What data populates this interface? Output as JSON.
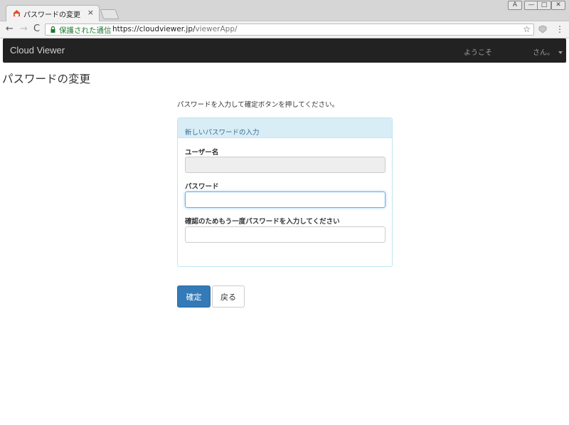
{
  "browser": {
    "tab_title": "パスワードの変更",
    "tab_close": "×",
    "secure_label": "保護された通信",
    "url_host": "https://cloudviewer.jp/",
    "url_path": "viewerApp/",
    "star": "☆",
    "back": "←",
    "forward": "→",
    "reload": "C",
    "menu": "⋮",
    "window_buttons": [
      "A",
      "—",
      "□",
      "✕"
    ]
  },
  "navbar": {
    "brand": "Cloud Viewer",
    "welcome": "ようこそ",
    "user_suffix": "さん。"
  },
  "page": {
    "title": "パスワードの変更",
    "instruction": "パスワードを入力して確定ボタンを押してください。"
  },
  "panel": {
    "heading": "新しいパスワードの入力",
    "username_label": "ユーザー名",
    "username_value": "",
    "password_label": "パスワード",
    "password_value": "",
    "confirm_label": "確認のためもう一度パスワードを入力してください",
    "confirm_value": ""
  },
  "buttons": {
    "confirm": "確定",
    "back": "戻る"
  },
  "colors": {
    "primary": "#337ab7",
    "navbar": "#222222",
    "panel_heading": "#d9edf7",
    "secure_green": "#1a7a2e"
  }
}
